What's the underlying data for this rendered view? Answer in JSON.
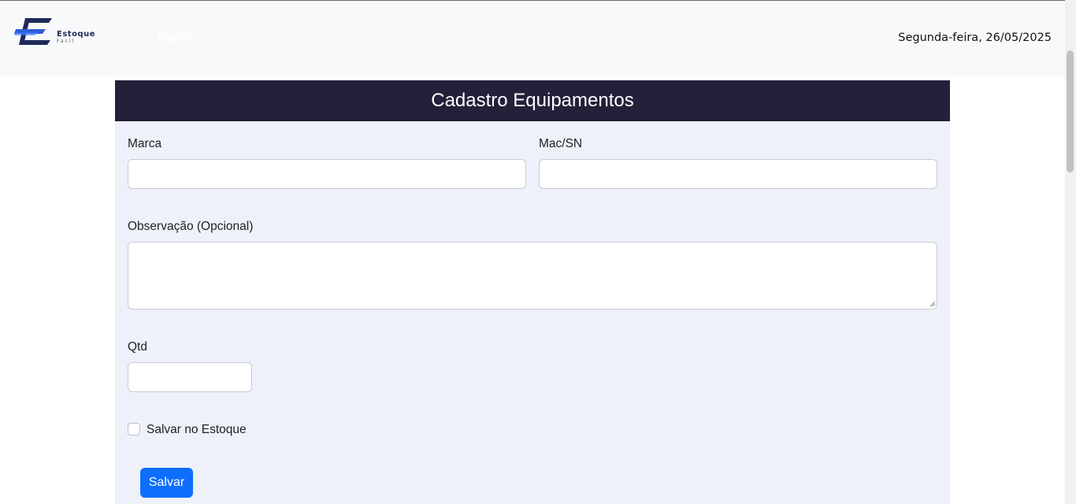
{
  "brand": {
    "logo_line1": "Estoque",
    "logo_line2": "Facil",
    "logo_colors": [
      "#1d2a5a",
      "#2d5fd6"
    ]
  },
  "nav": {
    "home_label": "Home",
    "date_text": "Segunda-feira, 26/05/2025"
  },
  "form": {
    "title": "Cadastro Equipamentos",
    "marca_label": "Marca",
    "marca_value": "",
    "macsn_label": "Mac/SN",
    "macsn_value": "",
    "observacao_label": "Observação (Opcional)",
    "observacao_value": "",
    "qtd_label": "Qtd",
    "qtd_value": "",
    "save_stock_label": "Salvar no Estoque",
    "save_stock_checked": false,
    "submit_label": "Salvar"
  },
  "colors": {
    "header_bg": "#232039",
    "body_bg": "#eef1f9",
    "primary": "#0d6efd"
  }
}
